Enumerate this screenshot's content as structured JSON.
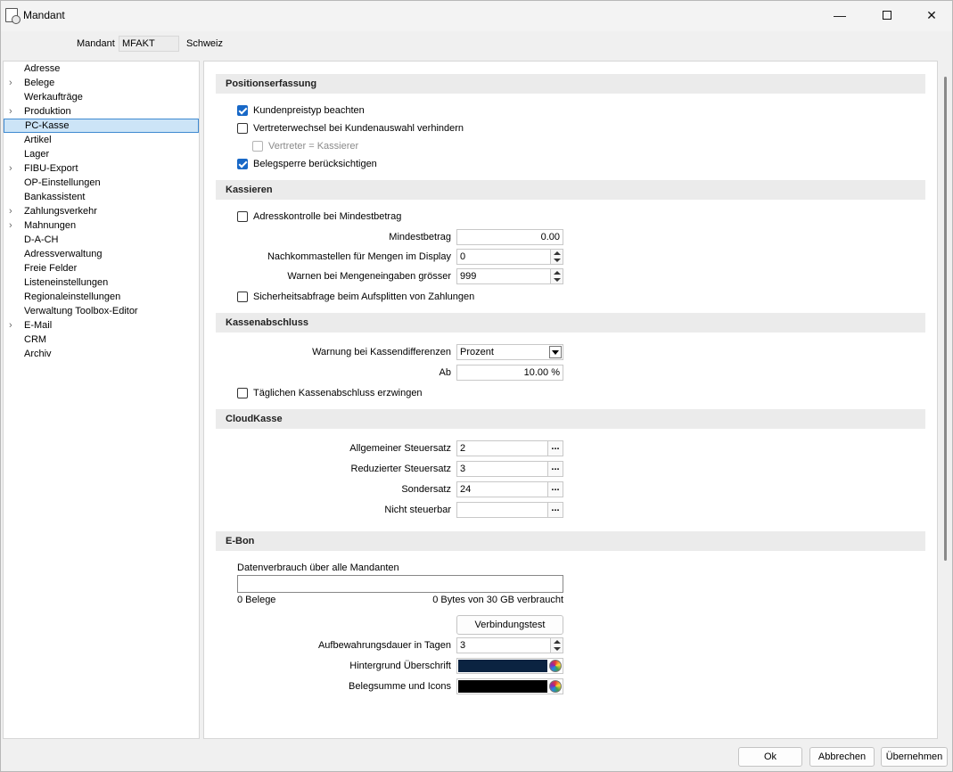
{
  "window": {
    "title": "Mandant"
  },
  "header": {
    "mandant_label": "Mandant",
    "mandant_code": "MFAKT",
    "mandant_name": "Schweiz"
  },
  "tree": [
    {
      "label": "Adresse",
      "expandable": false
    },
    {
      "label": "Belege",
      "expandable": true
    },
    {
      "label": "Werkaufträge",
      "expandable": false
    },
    {
      "label": "Produktion",
      "expandable": true
    },
    {
      "label": "PC-Kasse",
      "expandable": false,
      "selected": true
    },
    {
      "label": "Artikel",
      "expandable": false
    },
    {
      "label": "Lager",
      "expandable": false
    },
    {
      "label": "FIBU-Export",
      "expandable": true
    },
    {
      "label": "OP-Einstellungen",
      "expandable": false
    },
    {
      "label": "Bankassistent",
      "expandable": false
    },
    {
      "label": "Zahlungsverkehr",
      "expandable": true
    },
    {
      "label": "Mahnungen",
      "expandable": true
    },
    {
      "label": "D-A-CH",
      "expandable": false
    },
    {
      "label": "Adressverwaltung",
      "expandable": false
    },
    {
      "label": "Freie Felder",
      "expandable": false
    },
    {
      "label": "Listeneinstellungen",
      "expandable": false
    },
    {
      "label": "Regionaleinstellungen",
      "expandable": false
    },
    {
      "label": "Verwaltung Toolbox-Editor",
      "expandable": false
    },
    {
      "label": "E-Mail",
      "expandable": true
    },
    {
      "label": "CRM",
      "expandable": false
    },
    {
      "label": "Archiv",
      "expandable": false
    }
  ],
  "positionserfassung": {
    "title": "Positionserfassung",
    "kundenpreistyp": {
      "label": "Kundenpreistyp beachten",
      "checked": true
    },
    "vertreterwechsel": {
      "label": "Vertreterwechsel bei Kundenauswahl verhindern",
      "checked": false
    },
    "vertreter_kassierer": {
      "label": "Vertreter = Kassierer",
      "checked": false,
      "disabled": true
    },
    "belegsperre": {
      "label": "Belegsperre berücksichtigen",
      "checked": true
    }
  },
  "kassieren": {
    "title": "Kassieren",
    "adresskontrolle": {
      "label": "Adresskontrolle bei Mindestbetrag",
      "checked": false
    },
    "mindestbetrag_label": "Mindestbetrag",
    "mindestbetrag_value": "0.00",
    "nachkommastellen_label": "Nachkommastellen für Mengen im Display",
    "nachkommastellen_value": "0",
    "warnen_label": "Warnen bei Mengeneingaben grösser",
    "warnen_value": "999",
    "sicherheitsabfrage": {
      "label": "Sicherheitsabfrage beim Aufsplitten von Zahlungen",
      "checked": false
    }
  },
  "kassenabschluss": {
    "title": "Kassenabschluss",
    "warnung_label": "Warnung bei Kassendifferenzen",
    "warnung_value": "Prozent",
    "ab_label": "Ab",
    "ab_value": "10.00 %",
    "taeglich": {
      "label": "Täglichen Kassenabschluss erzwingen",
      "checked": false
    }
  },
  "cloudkasse": {
    "title": "CloudKasse",
    "allgemein_label": "Allgemeiner Steuersatz",
    "allgemein_value": "2",
    "reduziert_label": "Reduzierter Steuersatz",
    "reduziert_value": "3",
    "sondersatz_label": "Sondersatz",
    "sondersatz_value": "24",
    "nicht_steuerbar_label": "Nicht steuerbar",
    "nicht_steuerbar_value": "",
    "picker_label": "..."
  },
  "ebon": {
    "title": "E-Bon",
    "datenverbrauch_label": "Datenverbrauch über alle Mandanten",
    "usage_fraction": 0,
    "belege_text": "0 Belege",
    "bytes_text": "0 Bytes von 30 GB verbraucht",
    "verbindungstest_label": "Verbindungstest",
    "aufbewahrung_label": "Aufbewahrungsdauer in Tagen",
    "aufbewahrung_value": "3",
    "hintergrund_label": "Hintergrund Überschrift",
    "hintergrund_color": "#0b2341",
    "belegsumme_label": "Belegsumme und Icons",
    "belegsumme_color": "#000000"
  },
  "footer": {
    "ok_label": "Ok",
    "cancel_label": "Abbrechen",
    "apply_label": "Übernehmen"
  },
  "window_controls": {
    "minimize": "minimize-icon",
    "maximize": "maximize-icon",
    "close": "close-icon"
  }
}
